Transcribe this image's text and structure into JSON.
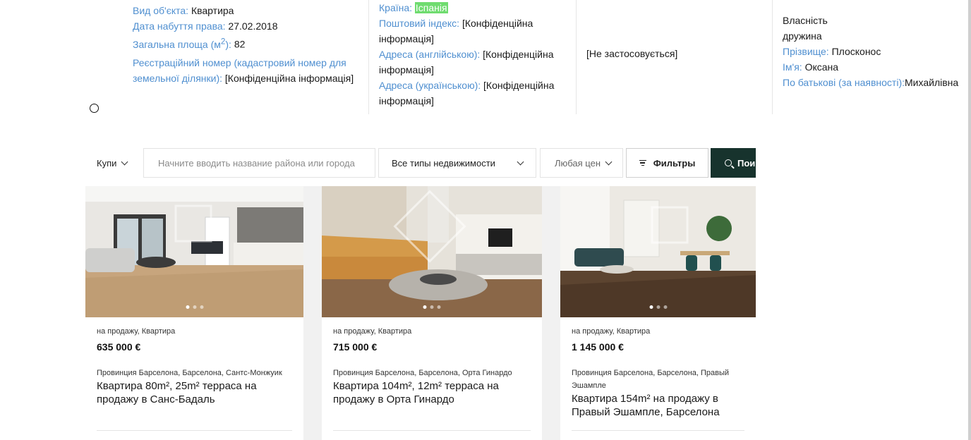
{
  "declaration": {
    "property": {
      "object_type_label": "Вид об'єкта:",
      "object_type_value": "Квартира",
      "acq_date_label": "Дата набуття права:",
      "acq_date_value": "27.02.2018",
      "area_label": "Загальна площа (м",
      "area_sup": "2",
      "area_label_end": "):",
      "area_value": "82",
      "reg_label": "Реєстраційний номер (кадастровий номер для земельної ділянки):",
      "reg_value": "[Конфіденційна інформація]"
    },
    "location": {
      "country_label": "Країна:",
      "country_value": "Іспанія",
      "postal_label": "Поштовий індекс:",
      "postal_value": "[Конфіденційна інформація]",
      "addr_en_label": "Адреса (англійською):",
      "addr_en_value": "[Конфіденційна інформація]",
      "addr_ua_label": "Адреса (українською):",
      "addr_ua_value": "[Конфіденційна інформація]"
    },
    "not_applicable": "[Не застосовується]",
    "owner": {
      "ownership": "Власність",
      "relation": "дружина",
      "surname_label": "Прізвище:",
      "surname_value": "Плосконос",
      "name_label": "Ім'я:",
      "name_value": "Оксана",
      "patronymic_label": "По батькові (за наявності):",
      "patronymic_value": "Михайлівна"
    }
  },
  "search": {
    "deal": "Купи",
    "location_placeholder": "Начните вводить название района или города",
    "property_type": "Все типы недвижимости",
    "price": "Любая цен",
    "filters": "Фильтры",
    "search": "Пои"
  },
  "listings": [
    {
      "deal_type": "на продажу, Квартира",
      "price": "635 000 €",
      "address": "Провинция Барселона, Барселона, Сантс-Монжуик",
      "title": "Квартира 80m², 25m² терраса на продажу в Санс-Бадаль"
    },
    {
      "deal_type": "на продажу, Квартира",
      "price": "715 000 €",
      "address": "Провинция Барселона, Барселона, Орта Гинардо",
      "title": "Квартира 104m², 12m² терраса на продажу в Орта Гинардо"
    },
    {
      "deal_type": "на продажу, Квартира",
      "price": "1 145 000 €",
      "address": "Провинция Барселона, Барселона, Правый Эшампле",
      "title": "Квартира 154m² на продажу в Правый Эшампле, Барселона"
    }
  ],
  "colors": {
    "label_blue": "#4f8fd0",
    "highlight_green": "#6fdc6f",
    "search_button": "#17332d"
  }
}
